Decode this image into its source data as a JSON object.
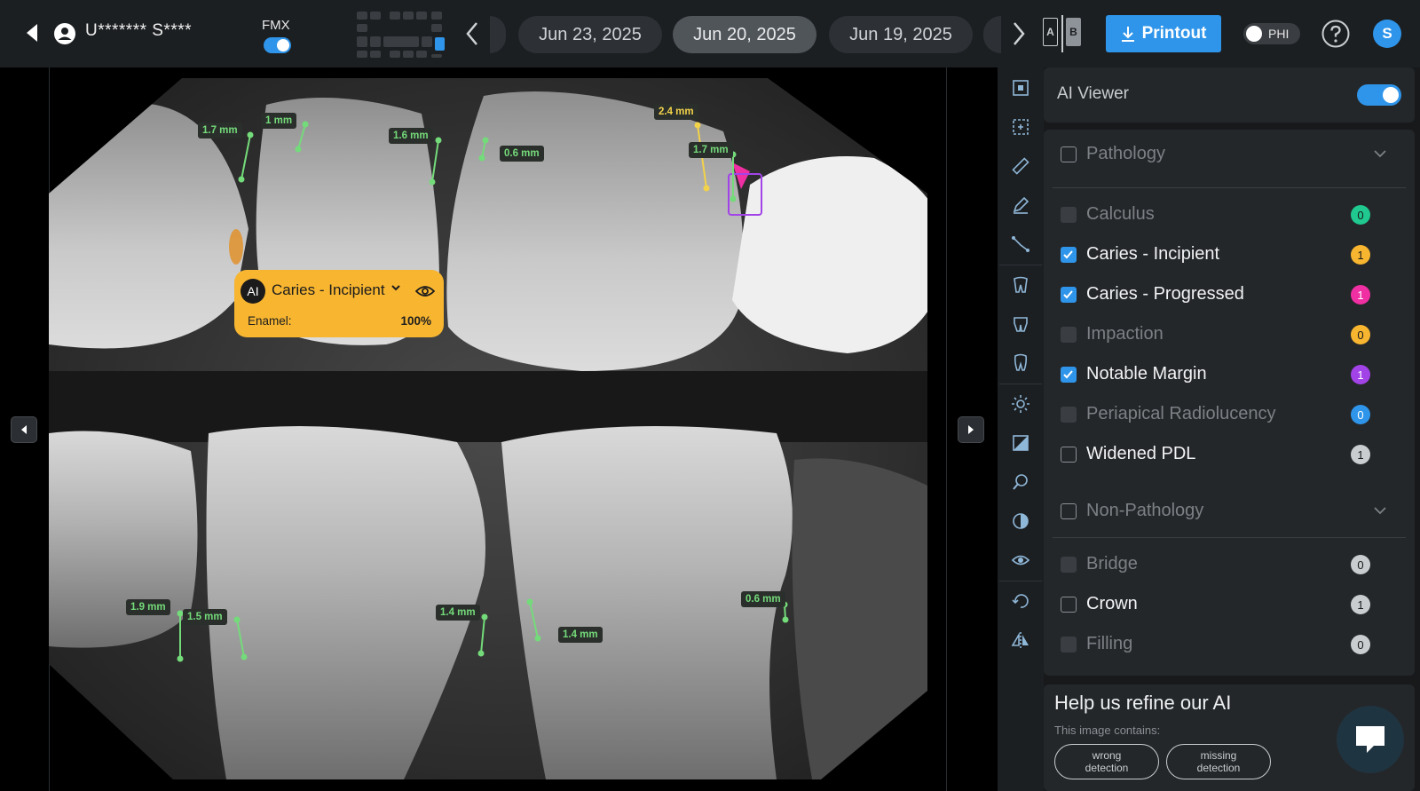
{
  "header": {
    "patient_name": "U******* S****",
    "fmx_label": "FMX",
    "dates": [
      "Jun 23, 2025",
      "Jun 20, 2025",
      "Jun 19, 2025"
    ],
    "active_date": "Jun 20, 2025",
    "compare_a": "A",
    "compare_b": "B",
    "printout_label": "Printout",
    "phi_label": "PHI",
    "avatar_initial": "S"
  },
  "measurements": [
    {
      "label": "1.7 mm",
      "color": "green"
    },
    {
      "label": "1 mm",
      "color": "green"
    },
    {
      "label": "1.6 mm",
      "color": "green"
    },
    {
      "label": "0.6 mm",
      "color": "green"
    },
    {
      "label": "2.4 mm",
      "color": "yellow"
    },
    {
      "label": "1.7 mm",
      "color": "green"
    },
    {
      "label": "1.9 mm",
      "color": "green"
    },
    {
      "label": "1.5 mm",
      "color": "green"
    },
    {
      "label": "1.4 mm",
      "color": "green"
    },
    {
      "label": "1.4 mm",
      "color": "green"
    },
    {
      "label": "0.6 mm",
      "color": "green"
    }
  ],
  "ai_popup": {
    "badge": "AI",
    "title": "Caries - Incipient",
    "enamel_label": "Enamel:",
    "enamel_value": "100%"
  },
  "panel": {
    "ai_viewer_label": "AI Viewer",
    "ai_viewer_on": true,
    "pathology_label": "Pathology",
    "pathology_items": [
      {
        "label": "Calculus",
        "count": "0",
        "checked": false,
        "enabled": false,
        "color": "#1fc98f"
      },
      {
        "label": "Caries - Incipient",
        "count": "1",
        "checked": true,
        "enabled": true,
        "color": "#f7b530"
      },
      {
        "label": "Caries - Progressed",
        "count": "1",
        "checked": true,
        "enabled": true,
        "color": "#ef2fa2"
      },
      {
        "label": "Impaction",
        "count": "0",
        "checked": false,
        "enabled": false,
        "color": "#f7b530"
      },
      {
        "label": "Notable Margin",
        "count": "1",
        "checked": true,
        "enabled": true,
        "color": "#a243e8"
      },
      {
        "label": "Periapical Radiolucency",
        "count": "0",
        "checked": false,
        "enabled": false,
        "color": "#2f95ea"
      },
      {
        "label": "Widened PDL",
        "count": "1",
        "checked": false,
        "enabled": true,
        "color": "#c9cdd0"
      }
    ],
    "non_pathology_label": "Non-Pathology",
    "non_pathology_items": [
      {
        "label": "Bridge",
        "count": "0",
        "checked": false,
        "enabled": false,
        "color": "#c9cdd0"
      },
      {
        "label": "Crown",
        "count": "1",
        "checked": false,
        "enabled": true,
        "color": "#c9cdd0"
      },
      {
        "label": "Filling",
        "count": "0",
        "checked": false,
        "enabled": false,
        "color": "#c9cdd0"
      }
    ],
    "feedback": {
      "title": "Help us refine our AI",
      "subtitle": "This image contains:",
      "wrong_line1": "wrong",
      "wrong_line2": "detection",
      "missing_line1": "missing",
      "missing_line2": "detection"
    }
  },
  "tools": [
    "crop-icon",
    "select-area-icon",
    "ruler-icon",
    "pen-icon",
    "angle-icon",
    "tooth-upper-icon",
    "tooth-lower-icon",
    "tooth-root-icon",
    "brightness-icon",
    "histogram-icon",
    "zoom-icon",
    "contrast-icon",
    "visibility-icon",
    "rotate-icon",
    "flip-icon"
  ]
}
